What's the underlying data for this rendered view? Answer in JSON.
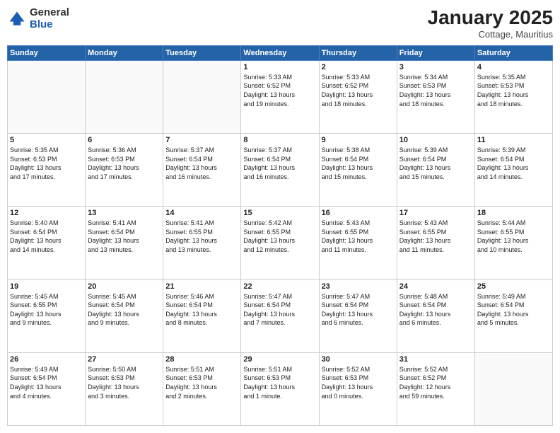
{
  "logo": {
    "general": "General",
    "blue": "Blue"
  },
  "header": {
    "month": "January 2025",
    "location": "Cottage, Mauritius"
  },
  "days_of_week": [
    "Sunday",
    "Monday",
    "Tuesday",
    "Wednesday",
    "Thursday",
    "Friday",
    "Saturday"
  ],
  "weeks": [
    [
      {
        "day": "",
        "text": ""
      },
      {
        "day": "",
        "text": ""
      },
      {
        "day": "",
        "text": ""
      },
      {
        "day": "1",
        "text": "Sunrise: 5:33 AM\nSunset: 6:52 PM\nDaylight: 13 hours\nand 19 minutes."
      },
      {
        "day": "2",
        "text": "Sunrise: 5:33 AM\nSunset: 6:52 PM\nDaylight: 13 hours\nand 18 minutes."
      },
      {
        "day": "3",
        "text": "Sunrise: 5:34 AM\nSunset: 6:53 PM\nDaylight: 13 hours\nand 18 minutes."
      },
      {
        "day": "4",
        "text": "Sunrise: 5:35 AM\nSunset: 6:53 PM\nDaylight: 13 hours\nand 18 minutes."
      }
    ],
    [
      {
        "day": "5",
        "text": "Sunrise: 5:35 AM\nSunset: 6:53 PM\nDaylight: 13 hours\nand 17 minutes."
      },
      {
        "day": "6",
        "text": "Sunrise: 5:36 AM\nSunset: 6:53 PM\nDaylight: 13 hours\nand 17 minutes."
      },
      {
        "day": "7",
        "text": "Sunrise: 5:37 AM\nSunset: 6:54 PM\nDaylight: 13 hours\nand 16 minutes."
      },
      {
        "day": "8",
        "text": "Sunrise: 5:37 AM\nSunset: 6:54 PM\nDaylight: 13 hours\nand 16 minutes."
      },
      {
        "day": "9",
        "text": "Sunrise: 5:38 AM\nSunset: 6:54 PM\nDaylight: 13 hours\nand 15 minutes."
      },
      {
        "day": "10",
        "text": "Sunrise: 5:39 AM\nSunset: 6:54 PM\nDaylight: 13 hours\nand 15 minutes."
      },
      {
        "day": "11",
        "text": "Sunrise: 5:39 AM\nSunset: 6:54 PM\nDaylight: 13 hours\nand 14 minutes."
      }
    ],
    [
      {
        "day": "12",
        "text": "Sunrise: 5:40 AM\nSunset: 6:54 PM\nDaylight: 13 hours\nand 14 minutes."
      },
      {
        "day": "13",
        "text": "Sunrise: 5:41 AM\nSunset: 6:54 PM\nDaylight: 13 hours\nand 13 minutes."
      },
      {
        "day": "14",
        "text": "Sunrise: 5:41 AM\nSunset: 6:55 PM\nDaylight: 13 hours\nand 13 minutes."
      },
      {
        "day": "15",
        "text": "Sunrise: 5:42 AM\nSunset: 6:55 PM\nDaylight: 13 hours\nand 12 minutes."
      },
      {
        "day": "16",
        "text": "Sunrise: 5:43 AM\nSunset: 6:55 PM\nDaylight: 13 hours\nand 11 minutes."
      },
      {
        "day": "17",
        "text": "Sunrise: 5:43 AM\nSunset: 6:55 PM\nDaylight: 13 hours\nand 11 minutes."
      },
      {
        "day": "18",
        "text": "Sunrise: 5:44 AM\nSunset: 6:55 PM\nDaylight: 13 hours\nand 10 minutes."
      }
    ],
    [
      {
        "day": "19",
        "text": "Sunrise: 5:45 AM\nSunset: 6:55 PM\nDaylight: 13 hours\nand 9 minutes."
      },
      {
        "day": "20",
        "text": "Sunrise: 5:45 AM\nSunset: 6:54 PM\nDaylight: 13 hours\nand 9 minutes."
      },
      {
        "day": "21",
        "text": "Sunrise: 5:46 AM\nSunset: 6:54 PM\nDaylight: 13 hours\nand 8 minutes."
      },
      {
        "day": "22",
        "text": "Sunrise: 5:47 AM\nSunset: 6:54 PM\nDaylight: 13 hours\nand 7 minutes."
      },
      {
        "day": "23",
        "text": "Sunrise: 5:47 AM\nSunset: 6:54 PM\nDaylight: 13 hours\nand 6 minutes."
      },
      {
        "day": "24",
        "text": "Sunrise: 5:48 AM\nSunset: 6:54 PM\nDaylight: 13 hours\nand 6 minutes."
      },
      {
        "day": "25",
        "text": "Sunrise: 5:49 AM\nSunset: 6:54 PM\nDaylight: 13 hours\nand 5 minutes."
      }
    ],
    [
      {
        "day": "26",
        "text": "Sunrise: 5:49 AM\nSunset: 6:54 PM\nDaylight: 13 hours\nand 4 minutes."
      },
      {
        "day": "27",
        "text": "Sunrise: 5:50 AM\nSunset: 6:53 PM\nDaylight: 13 hours\nand 3 minutes."
      },
      {
        "day": "28",
        "text": "Sunrise: 5:51 AM\nSunset: 6:53 PM\nDaylight: 13 hours\nand 2 minutes."
      },
      {
        "day": "29",
        "text": "Sunrise: 5:51 AM\nSunset: 6:53 PM\nDaylight: 13 hours\nand 1 minute."
      },
      {
        "day": "30",
        "text": "Sunrise: 5:52 AM\nSunset: 6:53 PM\nDaylight: 13 hours\nand 0 minutes."
      },
      {
        "day": "31",
        "text": "Sunrise: 5:52 AM\nSunset: 6:52 PM\nDaylight: 12 hours\nand 59 minutes."
      },
      {
        "day": "",
        "text": ""
      }
    ]
  ]
}
